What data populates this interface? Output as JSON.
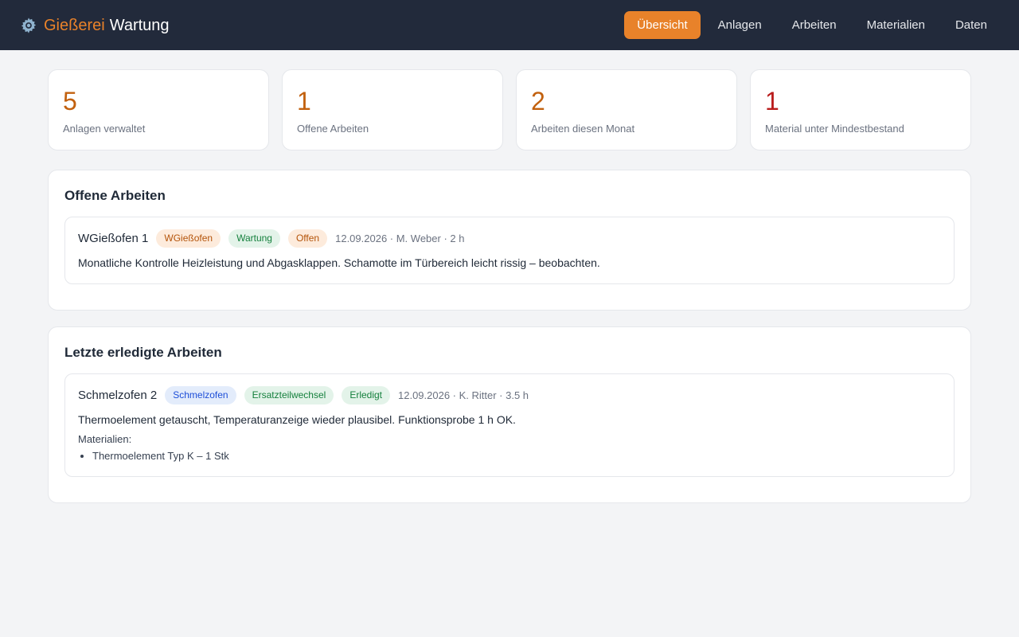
{
  "header": {
    "brand_accent": "Gießerei",
    "brand_main": "Wartung",
    "icon": "gear-icon",
    "nav": [
      "Übersicht",
      "Anlagen",
      "Arbeiten",
      "Materialien",
      "Daten"
    ],
    "active": "Übersicht"
  },
  "stats": [
    {
      "value": "5",
      "label": "Anlagen verwaltet"
    },
    {
      "value": "1",
      "label": "Offene Arbeiten"
    },
    {
      "value": "2",
      "label": "Arbeiten diesen Monat"
    },
    {
      "value": "1",
      "label": "Material unter Mindestbestand"
    }
  ],
  "open_jobs": {
    "title": "Offene Arbeiten",
    "items": [
      {
        "name": "WGießofen 1",
        "badges": [
          "WGießofen",
          "Wartung",
          "Offen"
        ],
        "meta": "12.09.2026 · M. Weber · 2 h",
        "description": "Monatliche Kontrolle Heizleistung und Abgasklappen. Schamotte im Türbereich leicht rissig – beobachten."
      }
    ]
  },
  "done_jobs": {
    "title": "Letzte erledigte Arbeiten",
    "items": [
      {
        "name": "Schmelzofen 2",
        "badges": [
          "Schmelzofen",
          "Ersatzteilwechsel",
          "Erledigt"
        ],
        "meta": "12.09.2026 · K. Ritter · 3.5 h",
        "description": "Thermoelement getauscht, Temperaturanzeige wieder plausibel. Funktionsprobe 1 h OK.",
        "materials_label": "Materialien:",
        "materials": [
          "Thermoelement Typ K – 1 Stk"
        ]
      }
    ]
  },
  "colors": {
    "topbar": "#222a3b",
    "accent": "#e8822a",
    "stat_value": "#c2610f",
    "stat_value_alert": "#b91c1c"
  }
}
